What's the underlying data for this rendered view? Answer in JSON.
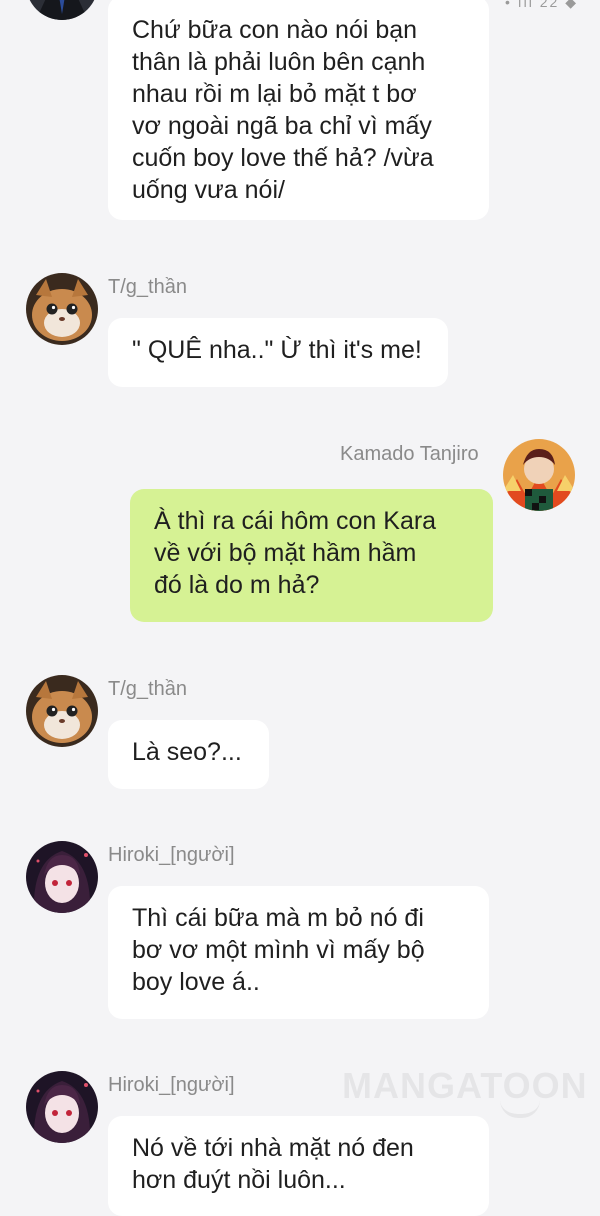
{
  "status_stub": "• ıll 22 ◆",
  "messages": [
    {
      "id": "m1",
      "sender": "",
      "avatar": "dark-suit-avatar-icon",
      "side": "left",
      "text": "Chứ bữa con nào nói bạn\nthân là phải luôn bên cạnh\nnhau rồi m lại bỏ mặt t bơ\nvơ ngoài ngã ba chỉ vì mấy\ncuốn boy love thế hả? /vừa\nuống vưa nói/"
    },
    {
      "id": "m2",
      "sender": "T/g_thần",
      "avatar": "cat-avatar-icon",
      "side": "left",
      "text": "\" QUÊ nha..\" Ừ thì it's me!"
    },
    {
      "id": "m3",
      "sender": "Kamado Tanjiro",
      "avatar": "tanjiro-avatar-icon",
      "side": "right",
      "text": "À thì ra cái hôm con Kara\nvề với bộ mặt hầm hầm\nđó là do m hả?"
    },
    {
      "id": "m4",
      "sender": "T/g_thần",
      "avatar": "cat-avatar-icon",
      "side": "left",
      "text": "Là seo?..."
    },
    {
      "id": "m5",
      "sender": "Hiroki_[người]",
      "avatar": "anime-girl-avatar-icon",
      "side": "left",
      "text": "Thì cái bữa mà m bỏ nó đi\nbơ vơ một mình vì mấy bộ\nboy love á.."
    },
    {
      "id": "m6",
      "sender": "Hiroki_[người]",
      "avatar": "anime-girl-avatar-icon",
      "side": "left",
      "text": "Nó về tới nhà mặt nó đen\nhơn đuýt nồi luôn..."
    }
  ],
  "watermark": "MANGATOON",
  "colors": {
    "background": "#f4f4f6",
    "bubble_other": "#ffffff",
    "bubble_mine": "#d6f294",
    "sender_name": "#8a8a8a",
    "text": "#1f1f1f"
  }
}
